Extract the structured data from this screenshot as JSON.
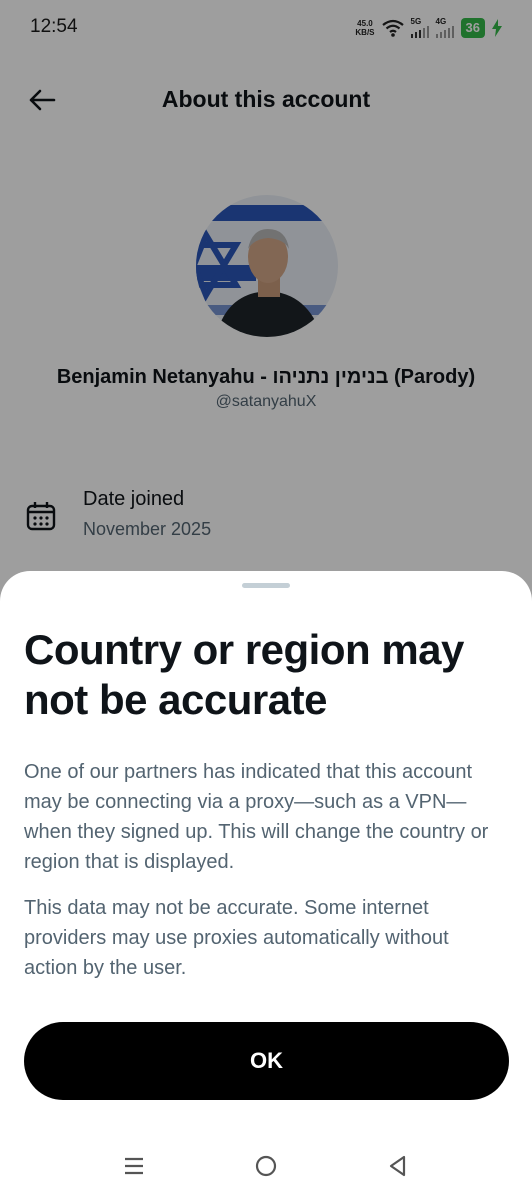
{
  "status_bar": {
    "time": "12:54",
    "net_speed_value": "45.0",
    "net_speed_unit": "KB/S",
    "signal1_label": "5G",
    "signal2_label": "4G",
    "battery": "36"
  },
  "header": {
    "title": "About this account",
    "back_icon": "arrow-left-icon"
  },
  "profile": {
    "name": "Benjamin Netanyahu - בנימין נתניהו (Parody)",
    "handle": "@satanyahuX"
  },
  "date_joined": {
    "label": "Date joined",
    "value": "November 2025",
    "icon": "calendar-icon"
  },
  "sheet": {
    "title": "Country or region may not be accurate",
    "paragraph1": "One of our partners has indicated that this account may be connecting via a proxy—such as a VPN—when they signed up. This will change the country or region that is displayed.",
    "paragraph2": "This data may not be accurate. Some internet providers may use proxies automatically without action by the user.",
    "ok_label": "OK"
  },
  "nav": {
    "menu_icon": "recent-apps-icon",
    "home_icon": "home-icon",
    "back_icon": "back-triangle-icon"
  },
  "colors": {
    "text_primary": "#0f1419",
    "text_secondary": "#536471",
    "button_bg": "#000000",
    "battery": "#35b94a"
  }
}
